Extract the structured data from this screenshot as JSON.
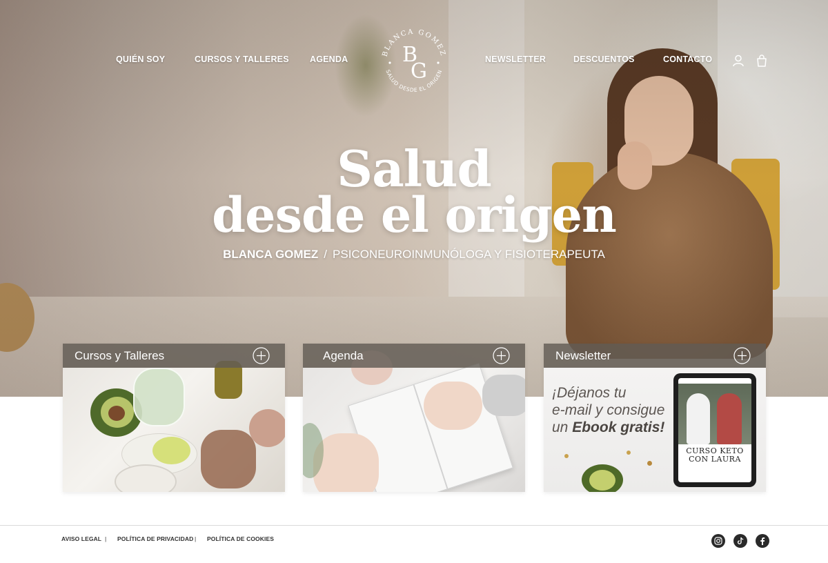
{
  "brand": {
    "logo_ring_top": "BLANCA GOMEZ",
    "logo_ring_bottom": "SALUD DESDE EL ORIGEN",
    "logo_monogram_1": "B",
    "logo_monogram_2": "G"
  },
  "nav": {
    "items": [
      {
        "label": "QUIÉN SOY"
      },
      {
        "label": "CURSOS Y TALLERES"
      },
      {
        "label": "AGENDA"
      },
      {
        "label": "NEWSLETTER"
      },
      {
        "label": "DESCUENTOS"
      },
      {
        "label": "CONTACTO"
      }
    ],
    "icons": [
      "user-icon",
      "shopping-bag-icon"
    ]
  },
  "hero": {
    "title_line1": "Salud",
    "title_line2": "desde el origen",
    "subtitle_name": "BLANCA GOMEZ",
    "subtitle_separator": "/",
    "subtitle_role": "PSICONEUROINMUNÓLOGA Y FISIOTERAPEUTA"
  },
  "cards": [
    {
      "title": "Cursos y Talleres",
      "icon": "plus-circle-icon"
    },
    {
      "title": "Agenda",
      "icon": "plus-circle-icon"
    },
    {
      "title": "Newsletter",
      "icon": "plus-circle-icon",
      "promo_line1": "¡Déjanos tu",
      "promo_line2": "e-mail y consigue",
      "promo_line3_prefix": "un",
      "promo_line3_bold": "Ebook gratis!",
      "ebook_title_line1": "CURSO KETO",
      "ebook_title_line2": "CON LAURA"
    }
  ],
  "footer": {
    "links": [
      {
        "label": "AVISO LEGAL"
      },
      {
        "label": "POLÍTICA DE PRIVACIDAD"
      },
      {
        "label": "POLÍTICA DE COOKIES"
      }
    ],
    "separator": "|",
    "social_icons": [
      "instagram-icon",
      "tiktok-icon",
      "facebook-icon"
    ]
  },
  "colors": {
    "card_header": "#625c54",
    "footer_text": "#333333",
    "hero_text": "#ffffff"
  }
}
